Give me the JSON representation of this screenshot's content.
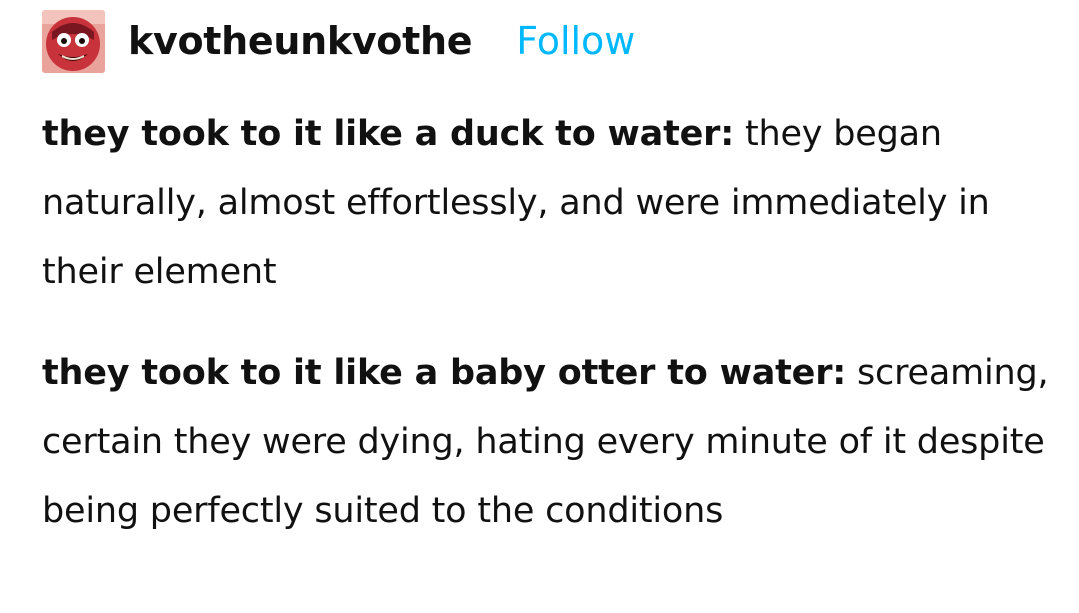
{
  "post": {
    "author": {
      "username": "kvotheunkvothe",
      "avatar_icon": "cartoon-character-avatar-icon",
      "follow_label": "Follow"
    },
    "paragraphs": [
      {
        "bold": "they took to it like a duck to water:",
        "text": " they began naturally, almost effortlessly, and were immediately in their element"
      },
      {
        "bold": "they took to it like a baby otter to water:",
        "text": " screaming, certain they were dying, hating every minute of it despite being perfectly suited to the conditions"
      }
    ]
  },
  "colors": {
    "follow": "#00b8ff",
    "text": "#111111",
    "background": "#ffffff"
  }
}
